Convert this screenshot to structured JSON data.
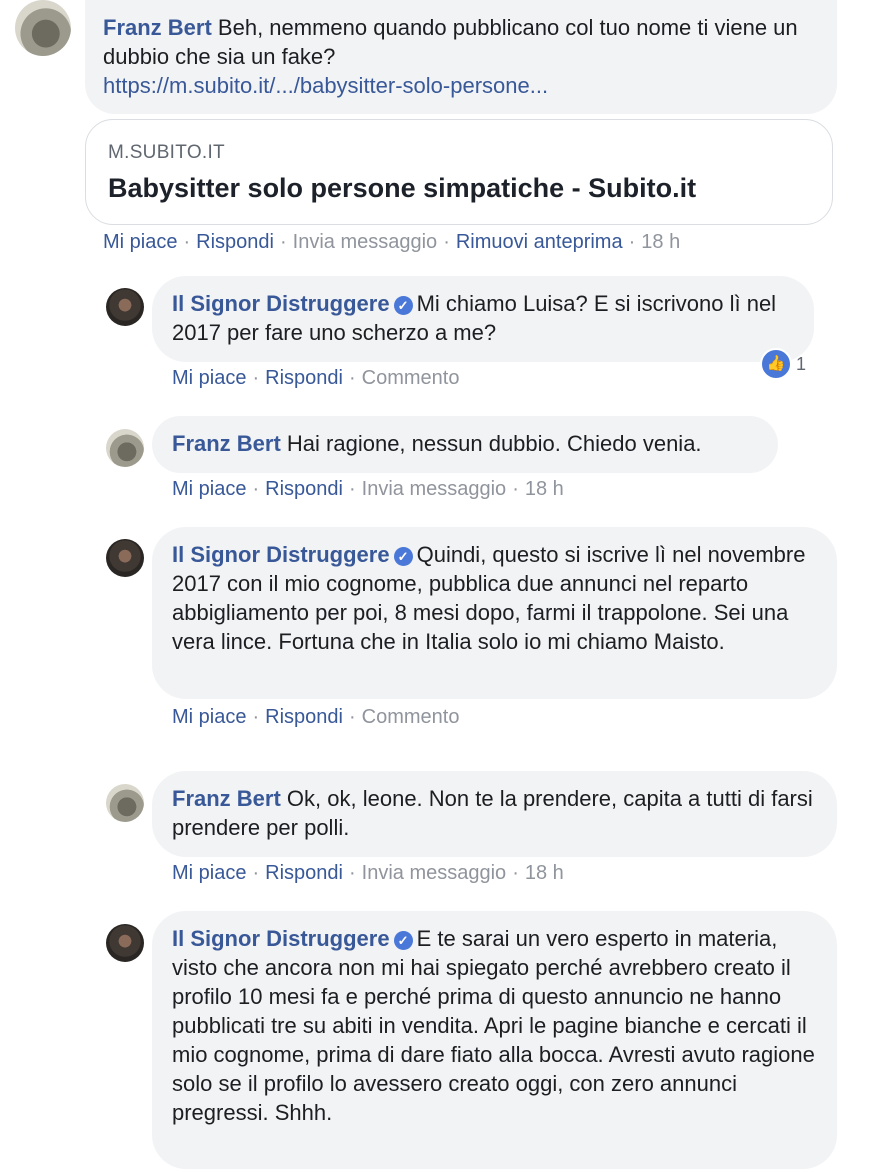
{
  "top_comment": {
    "author": "Franz Bert",
    "text": "Beh, nemmeno quando pubblicano col tuo nome ti viene un dubbio che sia un fake?",
    "link": "https://m.subito.it/.../babysitter-solo-persone...",
    "preview": {
      "domain": "M.SUBITO.IT",
      "title": "Babysitter solo persone simpatiche - Subito.it"
    },
    "actions": {
      "like": "Mi piace",
      "reply": "Rispondi",
      "message": "Invia messaggio",
      "remove_preview": "Rimuovi anteprima",
      "time": "18 h"
    }
  },
  "replies": [
    {
      "author": "Il Signor Distruggere",
      "verified": true,
      "text": "Mi chiamo Luisa? E si iscrivono lì nel 2017 per fare uno scherzo a me?",
      "actions": {
        "like": "Mi piace",
        "reply": "Rispondi",
        "extra": "Commento"
      },
      "reaction": {
        "icon": "thumbs-up-icon",
        "count": "1"
      }
    },
    {
      "author": "Franz Bert",
      "text": "Hai ragione, nessun dubbio. Chiedo venia.",
      "actions": {
        "like": "Mi piace",
        "reply": "Rispondi",
        "extra": "Invia messaggio",
        "time": "18 h"
      }
    },
    {
      "author": "Il Signor Distruggere",
      "verified": true,
      "text": "Quindi, questo si iscrive lì nel novembre 2017 con il mio cognome, pubblica due annunci nel reparto abbigliamento per poi, 8 mesi dopo, farmi il trappolone. Sei una vera lince. Fortuna che in Italia solo io mi chiamo Maisto.",
      "actions": {
        "like": "Mi piace",
        "reply": "Rispondi",
        "extra": "Commento"
      }
    },
    {
      "author": "Franz Bert",
      "text": "Ok, ok, leone. Non te la prendere, capita a tutti di farsi prendere per polli.",
      "actions": {
        "like": "Mi piace",
        "reply": "Rispondi",
        "extra": "Invia messaggio",
        "time": "18 h"
      }
    },
    {
      "author": "Il Signor Distruggere",
      "verified": true,
      "text": "E te sarai un vero esperto in materia, visto che ancora non mi hai spiegato perché avrebbero creato il profilo 10 mesi fa e perché prima di questo annuncio ne hanno pubblicati tre su abiti in vendita. Apri le pagine bianche e cercati il mio cognome, prima di dare fiato alla bocca. Avresti avuto ragione solo se il profilo lo avessero creato oggi, con zero annunci pregressi. Shhh."
    }
  ],
  "colors": {
    "author": "#385898",
    "bubble": "#f2f3f5",
    "muted": "#90949c",
    "verified": "#4a78d8"
  }
}
